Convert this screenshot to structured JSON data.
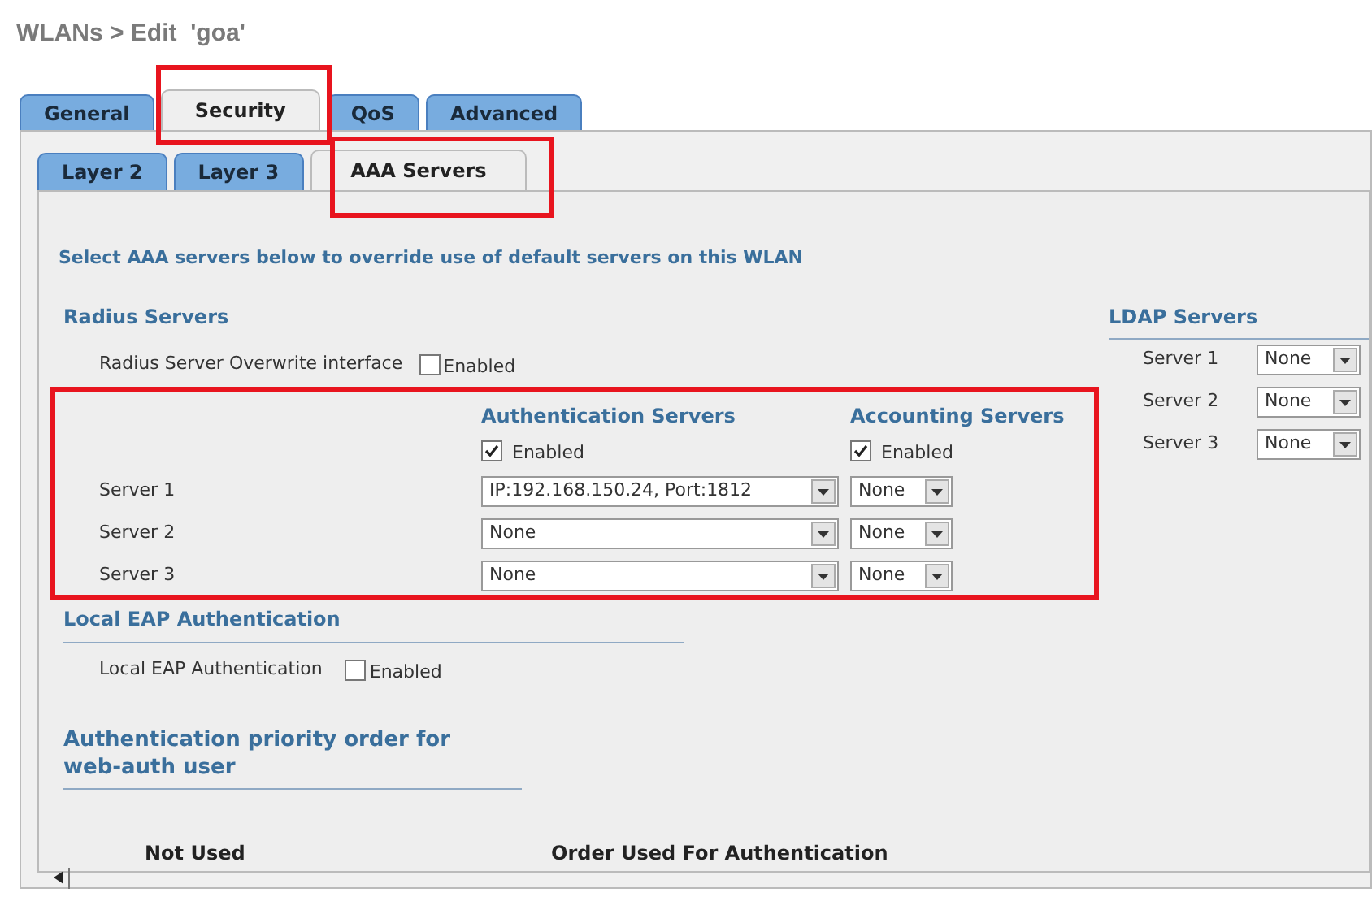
{
  "title": "WLANs > Edit  'goa'",
  "tabs": [
    {
      "label": "General",
      "selected": false
    },
    {
      "label": "Security",
      "selected": true
    },
    {
      "label": "QoS",
      "selected": false
    },
    {
      "label": "Advanced",
      "selected": false
    }
  ],
  "subtabs": [
    {
      "label": "Layer 2",
      "selected": false
    },
    {
      "label": "Layer 3",
      "selected": false
    },
    {
      "label": "AAA Servers",
      "selected": true
    }
  ],
  "intro": "Select AAA servers below to override use of default servers on this WLAN",
  "radius": {
    "heading": "Radius Servers",
    "overwrite": {
      "label": "Radius Server Overwrite interface",
      "checkbox_label": "Enabled",
      "checked": false
    },
    "auth_heading": "Authentication Servers",
    "acct_heading": "Accounting Servers",
    "auth_enabled": {
      "label": "Enabled",
      "checked": true
    },
    "acct_enabled": {
      "label": "Enabled",
      "checked": true
    },
    "servers": [
      {
        "label": "Server 1",
        "auth_value": "IP:192.168.150.24, Port:1812",
        "acct_value": "None"
      },
      {
        "label": "Server 2",
        "auth_value": "None",
        "acct_value": "None"
      },
      {
        "label": "Server 3",
        "auth_value": "None",
        "acct_value": "None"
      }
    ]
  },
  "ldap": {
    "heading": "LDAP Servers",
    "servers": [
      {
        "label": "Server 1",
        "value": "None"
      },
      {
        "label": "Server 2",
        "value": "None"
      },
      {
        "label": "Server 3",
        "value": "None"
      }
    ]
  },
  "local_eap": {
    "heading": "Local EAP Authentication",
    "label": "Local EAP Authentication",
    "checkbox_label": "Enabled",
    "checked": false
  },
  "priority": {
    "heading": "Authentication priority order for web-auth user",
    "columns": [
      "Not Used",
      "Order Used For Authentication"
    ]
  }
}
